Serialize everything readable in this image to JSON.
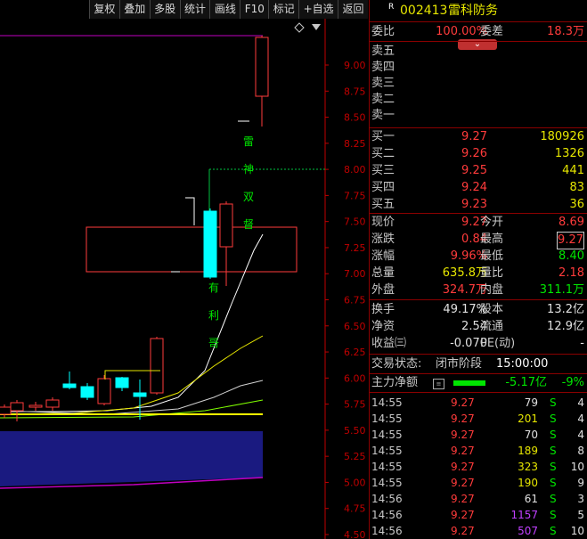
{
  "toolbar": [
    "复权",
    "叠加",
    "多股",
    "统计",
    "画线",
    "F10",
    "标记",
    "+自选",
    "返回"
  ],
  "header": {
    "marker": "R",
    "code": "002413",
    "name": "雷科防务"
  },
  "summary": {
    "weibi_label": "委比",
    "weibi": "100.00%",
    "weicha_label": "委差",
    "weicha": "18.3万"
  },
  "sell_orders": [
    {
      "label": "卖五",
      "price": "",
      "volume": ""
    },
    {
      "label": "卖四",
      "price": "",
      "volume": ""
    },
    {
      "label": "卖三",
      "price": "",
      "volume": ""
    },
    {
      "label": "卖二",
      "price": "",
      "volume": ""
    },
    {
      "label": "卖一",
      "price": "",
      "volume": ""
    }
  ],
  "buy_orders": [
    {
      "label": "买一",
      "price": "9.27",
      "volume": "180926"
    },
    {
      "label": "买二",
      "price": "9.26",
      "volume": "1326"
    },
    {
      "label": "买三",
      "price": "9.25",
      "volume": "441"
    },
    {
      "label": "买四",
      "price": "9.24",
      "volume": "83"
    },
    {
      "label": "买五",
      "price": "9.23",
      "volume": "36"
    }
  ],
  "stats": [
    {
      "l1": "现价",
      "v1": "9.27",
      "c1": "red",
      "l2": "今开",
      "v2": "8.69",
      "c2": "red"
    },
    {
      "l1": "涨跌",
      "v1": "0.84",
      "c1": "red",
      "l2": "最高",
      "v2": "9.27",
      "c2": "red"
    },
    {
      "l1": "涨幅",
      "v1": "9.96%",
      "c1": "red",
      "l2": "最低",
      "v2": "8.40",
      "c2": "green"
    },
    {
      "l1": "总量",
      "v1": "635.8万",
      "c1": "yel",
      "l2": "量比",
      "v2": "2.18",
      "c2": "red"
    },
    {
      "l1": "外盘",
      "v1": "324.7万",
      "c1": "red",
      "l2": "内盘",
      "v2": "311.1万",
      "c2": "green"
    }
  ],
  "fundamentals": [
    {
      "l1": "换手",
      "v1": "49.17%",
      "l2": "股本",
      "v2": "13.2亿"
    },
    {
      "l1": "净资",
      "v1": "2.54",
      "l2": "流通",
      "v2": "12.9亿"
    },
    {
      "l1": "收益㈢",
      "v1": "-0.070",
      "l2": "PE(动)",
      "v2": "-"
    }
  ],
  "trade_status": {
    "label": "交易状态:",
    "value": "闭市阶段",
    "time": "15:00:00"
  },
  "main_flow": {
    "label": "主力净额",
    "value": "-5.17亿",
    "pct": "-9%"
  },
  "ticks": [
    {
      "time": "14:55",
      "price": "9.27",
      "vol": "79",
      "vcol": "wht",
      "side": "S",
      "n": "4"
    },
    {
      "time": "14:55",
      "price": "9.27",
      "vol": "201",
      "vcol": "yel",
      "side": "S",
      "n": "4"
    },
    {
      "time": "14:55",
      "price": "9.27",
      "vol": "70",
      "vcol": "wht",
      "side": "S",
      "n": "4"
    },
    {
      "time": "14:55",
      "price": "9.27",
      "vol": "189",
      "vcol": "yel",
      "side": "S",
      "n": "8"
    },
    {
      "time": "14:55",
      "price": "9.27",
      "vol": "323",
      "vcol": "yel",
      "side": "S",
      "n": "10"
    },
    {
      "time": "14:55",
      "price": "9.27",
      "vol": "190",
      "vcol": "yel",
      "side": "S",
      "n": "9"
    },
    {
      "time": "14:56",
      "price": "9.27",
      "vol": "61",
      "vcol": "wht",
      "side": "S",
      "n": "3"
    },
    {
      "time": "14:56",
      "price": "9.27",
      "vol": "1157",
      "vcol": "purp",
      "side": "S",
      "n": "5"
    },
    {
      "time": "14:56",
      "price": "9.27",
      "vol": "507",
      "vcol": "purp",
      "side": "S",
      "n": "10"
    }
  ],
  "chart_data": {
    "type": "candlestick",
    "y_ticks": [
      "9.00",
      "8.75",
      "8.50",
      "8.25",
      "8.00",
      "7.75",
      "7.50",
      "7.25",
      "7.00",
      "6.75",
      "6.50",
      "6.25",
      "6.00",
      "5.75",
      "5.50",
      "5.25",
      "5.00",
      "4.75",
      "4.50"
    ],
    "ylim": [
      4.5,
      9.27
    ],
    "annotation_left": [
      "雷",
      "神",
      "双",
      "督"
    ],
    "annotation_right": [
      "有",
      "利",
      "哥"
    ],
    "colors": {
      "up": "#ff3b3b",
      "down": "#00ffff",
      "axis": "#c00000"
    }
  }
}
